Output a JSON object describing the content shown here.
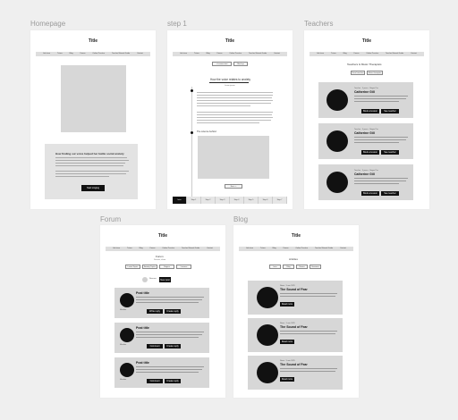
{
  "frames": {
    "homepage": {
      "label": "Homepage",
      "title": "Title"
    },
    "step1": {
      "label": "step 1",
      "title": "Title"
    },
    "teachers": {
      "label": "Teachers",
      "title": "Title"
    },
    "forum": {
      "label": "Forum",
      "title": "Title"
    },
    "blog": {
      "label": "Blog",
      "title": "Title"
    }
  },
  "nav": [
    "Link item",
    "Tutors",
    "Blog",
    "Forum",
    "Online Practice",
    "Teacher Manual Guide",
    "Contact"
  ],
  "homepage": {
    "headline": "How finding our voice helped her battle social anxiety",
    "cta": "Start singing"
  },
  "step1": {
    "top_buttons": [
      "< Lesson start",
      "Mark up"
    ],
    "heading": "How the voice relates to anxiety",
    "subheading": "Lorem ipsum",
    "section2": "The science behind",
    "next_button": "Next ->",
    "tabs": [
      "Intro",
      "Step 1",
      "Step 2",
      "Step 3",
      "Step 4",
      "Step 5",
      "Step 6",
      "Step 7"
    ]
  },
  "teachers": {
    "heading": "Teachers & Music Therapists",
    "filters": [
      "Vocal coaches",
      "Music therapists"
    ],
    "cards": [
      {
        "meta": "Teacher · 5 years  ·  Singer Pro",
        "name": "Catherine Gill",
        "btn1": "Book a lesson",
        "btn2": "See teacher"
      },
      {
        "meta": "Teacher · 5 years  ·  Singer Pro",
        "name": "Catherine Gill",
        "btn1": "Book a lesson",
        "btn2": "See teacher"
      },
      {
        "meta": "Teacher · 5 years  ·  Singer Pro",
        "name": "Catherine Gill",
        "btn1": "Book a lesson",
        "btn2": "See teacher"
      }
    ]
  },
  "forum": {
    "heading": "Forum",
    "subheading": "Discuss, share",
    "filters": [
      "Latest Topics",
      "Anxiety Topics",
      "Singers",
      "Lessons"
    ],
    "toggle_labels": [
      "Discuss",
      "New post"
    ],
    "posts": [
      {
        "title": "Post title",
        "author": "Member",
        "btn1": "Write reply",
        "btn2": "Create reply"
      },
      {
        "title": "Post title",
        "author": "Member",
        "btn1": "Comment",
        "btn2": "Create reply"
      },
      {
        "title": "Post title",
        "author": "Member",
        "btn1": "Comment",
        "btn2": "Create reply"
      }
    ]
  },
  "blog": {
    "heading": "Articles",
    "filters": [
      "Intro",
      "Blog",
      "Stories",
      "Seminars"
    ],
    "posts": [
      {
        "meta": "News  ·  5 min 2025",
        "title": "The Sound of Fear",
        "btn": "Read more"
      },
      {
        "meta": "News  ·  5 min 2025",
        "title": "The Sound of Fear",
        "btn": "Read more"
      },
      {
        "meta": "News  ·  5 min 2025",
        "title": "The Sound of Fear",
        "btn": "Read more"
      }
    ]
  }
}
